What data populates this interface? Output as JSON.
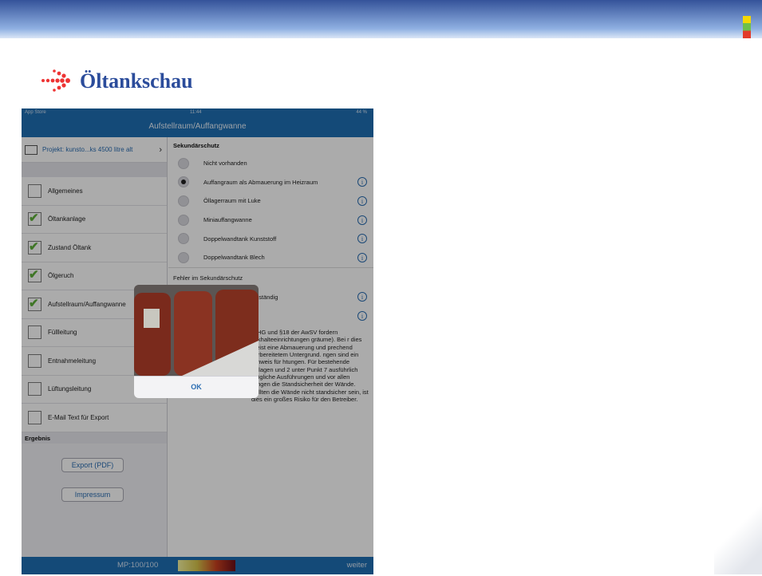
{
  "slide": {
    "title": "Öltankschau"
  },
  "screen1": {
    "status_left": "App Store",
    "status_time": "11:44",
    "status_right": "44 %",
    "nav_title": "Aufstellraum/Auffangwanne",
    "project": "Projekt: kunsto...ks 4500 litre alt",
    "items": [
      {
        "label": "Allgemeines",
        "checked": false
      },
      {
        "label": "Öltankanlage",
        "checked": true
      },
      {
        "label": "Zustand Öltank",
        "checked": true
      },
      {
        "label": "Ölgeruch",
        "checked": true
      },
      {
        "label": "Aufstellraum/Auffangwanne",
        "checked": true
      },
      {
        "label": "Füllleitung",
        "checked": false
      },
      {
        "label": "Entnahmeleitung",
        "checked": false
      },
      {
        "label": "Lüftungsleitung",
        "checked": false
      },
      {
        "label": "E-Mail Text für Export",
        "checked": false
      }
    ],
    "ergebnis": "Ergebnis",
    "export_btn": "Export (PDF)",
    "impressum_btn": "Impressum",
    "section": "Sekundärschutz",
    "options": [
      {
        "label": "Nicht vorhanden",
        "selected": false,
        "info": false
      },
      {
        "label": "Auffangraum als Abmauerung im Heizraum",
        "selected": true,
        "info": true
      },
      {
        "label": "Öllagerraum mit Luke",
        "selected": false,
        "info": true
      },
      {
        "label": "Miniauffangwanne",
        "selected": false,
        "info": true
      },
      {
        "label": "Doppelwandtank Kunststoff",
        "selected": false,
        "info": true
      },
      {
        "label": "Doppelwandtank Blech",
        "selected": false,
        "info": true
      }
    ],
    "fehler": "Fehler im Sekundärschutz",
    "fehler_opt": "vollständig",
    "body_visible": "WHG und §18 der AwSV fordern ückhalteeinrichtungen gräume). Bei r dies meist eine Abmauerung und prechend vorbereitetem Untergrund. ngen sind ein Hinweis für htungen. Für bestehende Anlagen und 2 unter Punkt 7 ausführlich mögliche Ausführungen und vor allen Dingen die Standsicherheit der Wände. Sollten die Wände nicht standsicher sein, ist dies ein großes Risiko für den Betreiber.",
    "mp": "MP:100/100",
    "weiter": "weiter",
    "popup_ok": "OK"
  }
}
